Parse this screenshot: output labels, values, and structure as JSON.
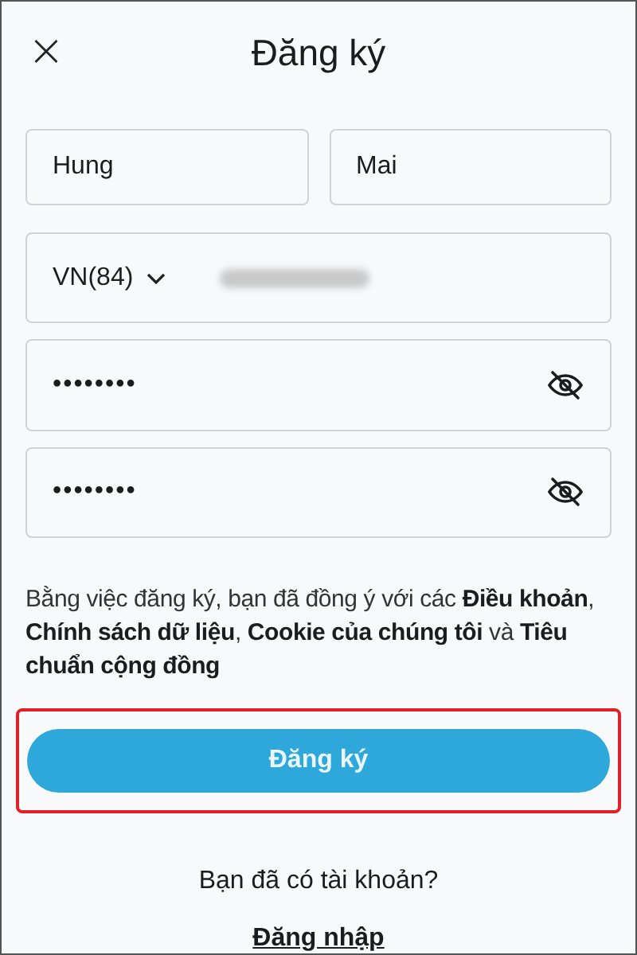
{
  "header": {
    "title": "Đăng ký",
    "close": "×"
  },
  "name_fields": [
    {
      "value": "Hung"
    },
    {
      "value": "Mai"
    }
  ],
  "phone": {
    "country": "VN(84)",
    "number_blurred": true
  },
  "password_fields": [
    {
      "value": "••••••••",
      "revealed": false
    },
    {
      "value": "••••••••",
      "revealed": false
    }
  ],
  "terms": "Bằng việc đăng ký, bạn đã đồng ý với các **Điều khoản**, **Chính sách dữ liệu**, **Cookie của chúng tôi** và **Tiêu chuẩn cộng đồng**",
  "submit": {
    "label": "Đăng ký",
    "highlighted": true
  },
  "login_prompt": "Bạn đã có tài khoản?",
  "login_link": "Đăng nhập"
}
